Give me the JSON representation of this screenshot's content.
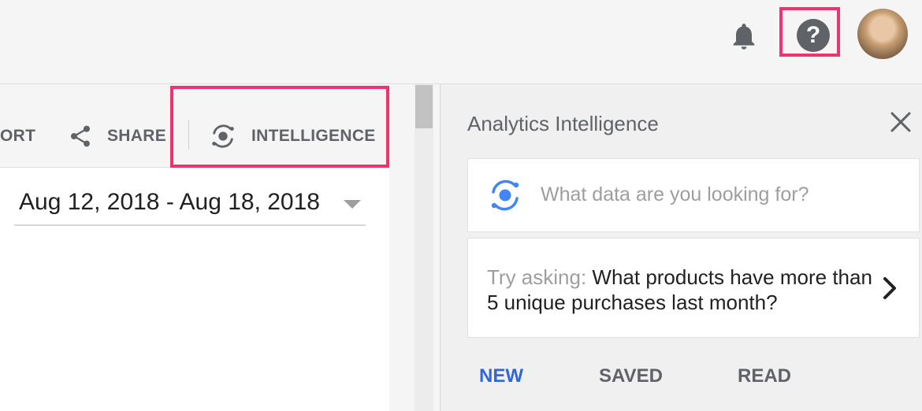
{
  "header": {
    "icons": [
      "bell-icon",
      "help-icon",
      "avatar"
    ],
    "help_glyph": "?"
  },
  "toolbar": {
    "export_label": "ORT",
    "share_label": "SHARE",
    "intelligence_label": "INTELLIGENCE"
  },
  "date_range": {
    "value": "Aug 12, 2018 - Aug 18, 2018"
  },
  "panel": {
    "title": "Analytics Intelligence",
    "search_placeholder": "What data are you looking for?",
    "suggestion_prefix": "Try asking: ",
    "suggestion_text": "What products have more than 5 unique purchases last month?",
    "tabs": [
      {
        "label": "NEW",
        "active": true
      },
      {
        "label": "SAVED",
        "active": false
      },
      {
        "label": "READ",
        "active": false
      }
    ]
  },
  "colors": {
    "highlight": "#f0326e",
    "accent": "#3367d6",
    "intelligence_blue": "#4285f4"
  }
}
